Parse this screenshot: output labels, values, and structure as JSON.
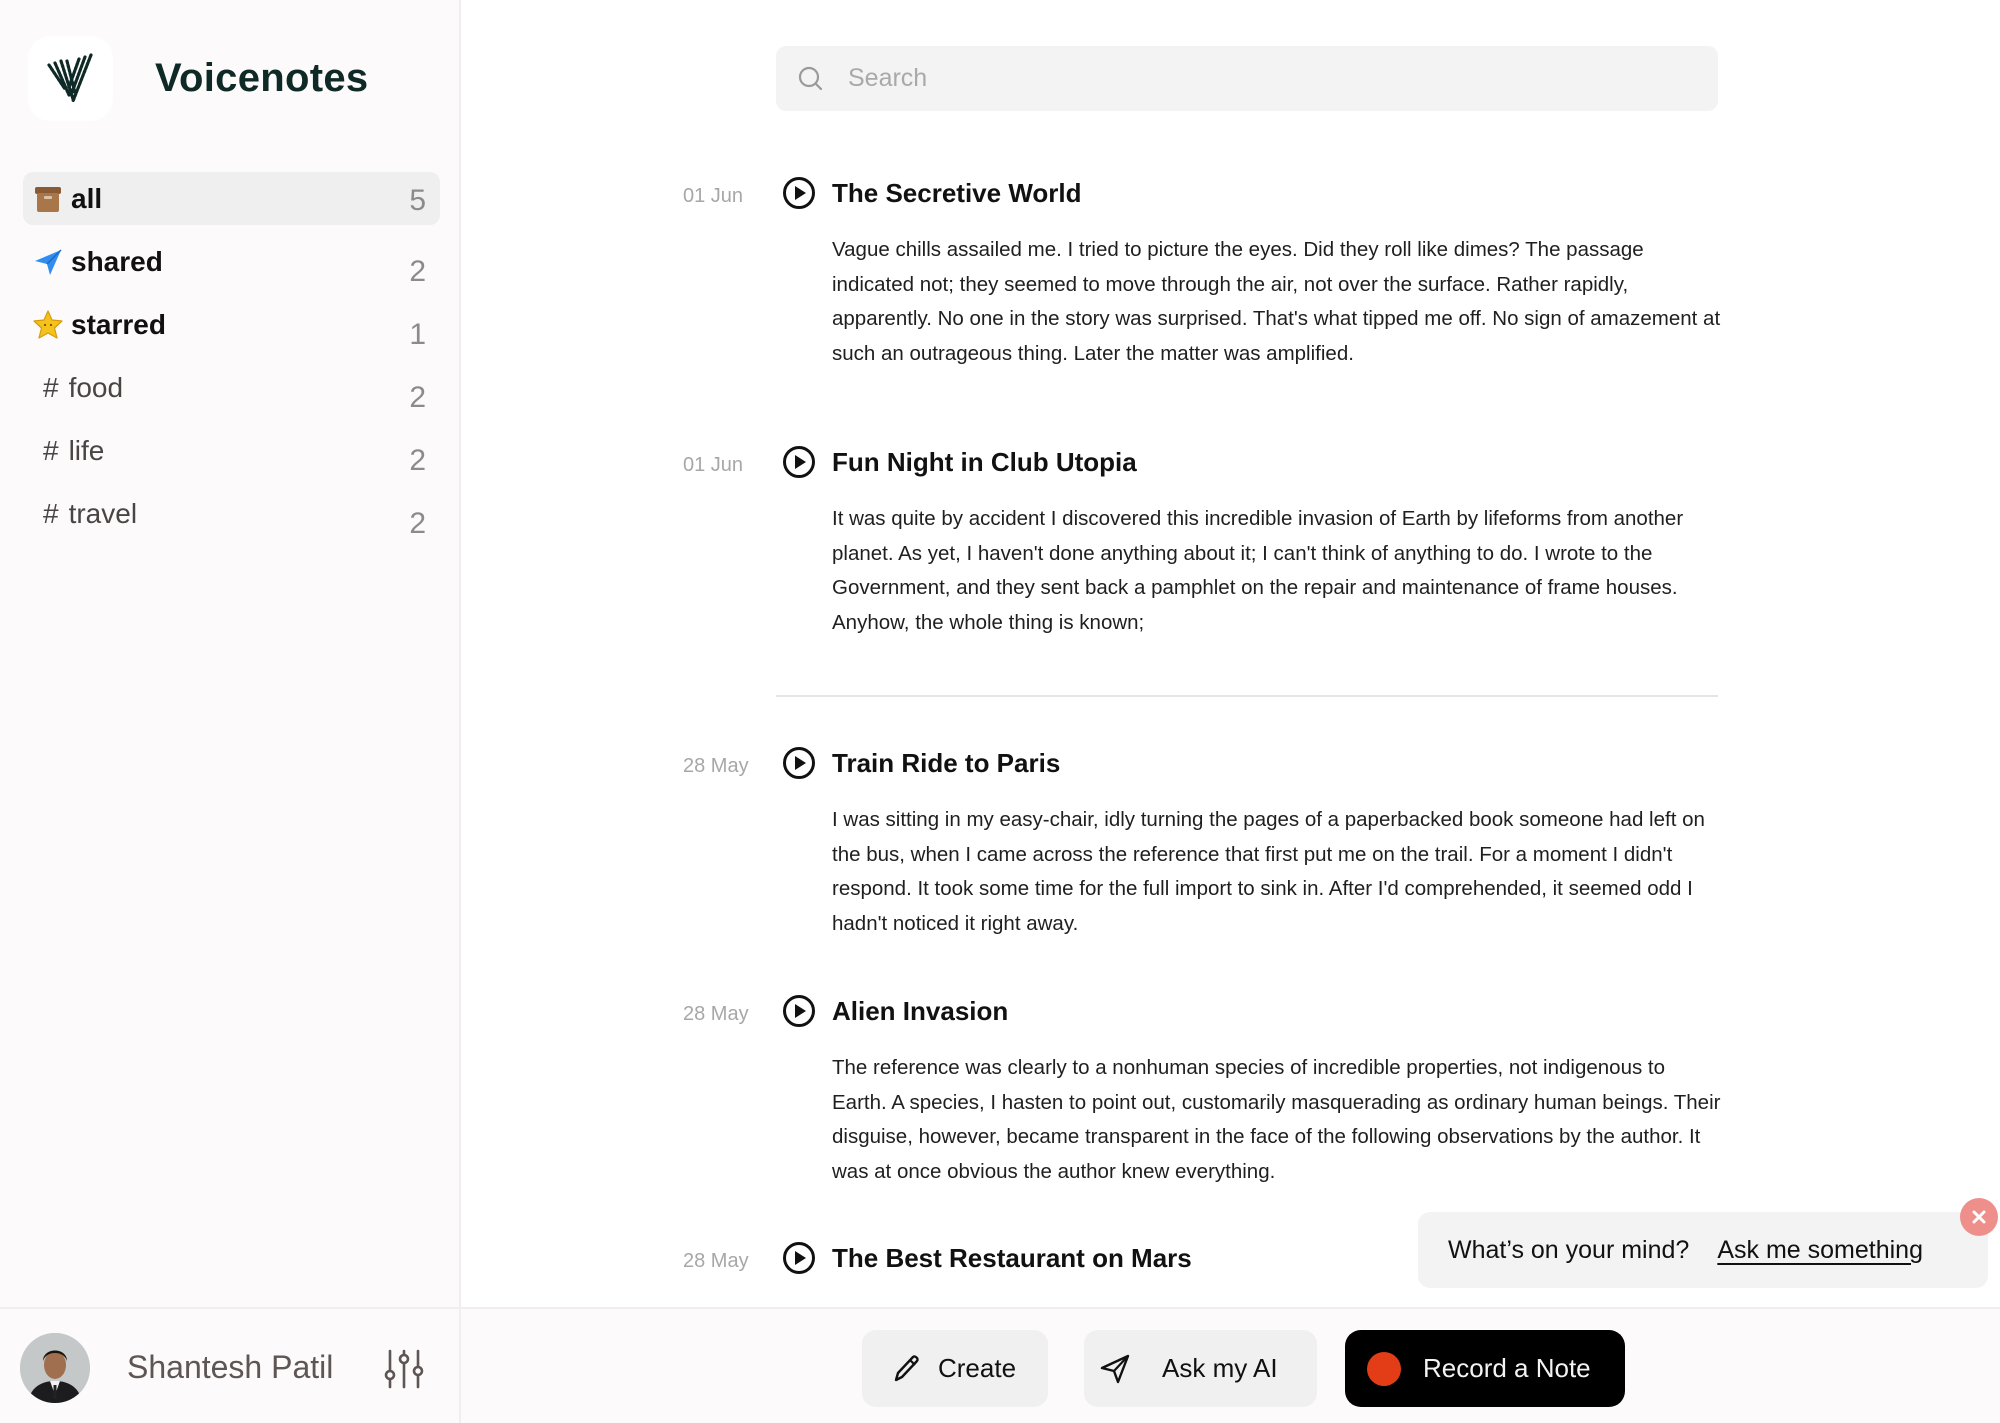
{
  "app": {
    "brand": "Voicenotes"
  },
  "sidebar": {
    "items": [
      {
        "label": "all",
        "count": "5",
        "icon": "archive-box-icon",
        "active": true
      },
      {
        "label": "shared",
        "count": "2",
        "icon": "paper-plane-icon"
      },
      {
        "label": "starred",
        "count": "1",
        "icon": "star-icon"
      },
      {
        "label": "food",
        "count": "2",
        "icon": "hash-icon",
        "prefix": "#"
      },
      {
        "label": "life",
        "count": "2",
        "icon": "hash-icon",
        "prefix": "#"
      },
      {
        "label": "travel",
        "count": "2",
        "icon": "hash-icon",
        "prefix": "#"
      }
    ]
  },
  "user": {
    "name": "Shantesh Patil"
  },
  "search": {
    "placeholder": "Search",
    "value": ""
  },
  "notes": [
    {
      "date": "01 Jun",
      "title": "The Secretive World",
      "body": "Vague chills assailed me. I tried to picture the eyes. Did they roll like dimes? The passage indicated not; they seemed to move through the air, not over the surface. Rather rapidly, apparently. No one in the story was surprised. That's what tipped me off. No sign of amazement at such an outrageous thing. Later the matter was amplified."
    },
    {
      "date": "01 Jun",
      "title": "Fun Night in Club Utopia",
      "body": "It was quite by accident I discovered this incredible invasion of Earth by lifeforms from another planet. As yet, I haven't done anything about it; I can't think of anything to do. I wrote to the Government, and they sent back a pamphlet on the repair and maintenance of frame houses. Anyhow, the whole thing is known;"
    },
    {
      "date": "28 May",
      "title": "Train Ride to Paris",
      "body": "I was sitting in my easy-chair, idly turning the pages of a paperbacked book someone had left on the bus, when I came across the reference that first put me on the trail. For a moment I didn't respond. It took some time for the full import to sink in. After I'd comprehended, it seemed odd I hadn't noticed it right away."
    },
    {
      "date": "28 May",
      "title": "Alien Invasion",
      "body": "The reference was clearly to a nonhuman species of incredible properties, not indigenous to Earth. A species, I hasten to point out, customarily masquerading as ordinary human beings. Their disguise, however, became transparent in the face of the following observations by the author. It was at once obvious the author knew everything."
    },
    {
      "date": "28 May",
      "title": "The Best Restaurant on Mars",
      "body": ""
    }
  ],
  "ask_popup": {
    "question": "What’s on your mind?",
    "link": "Ask me something"
  },
  "actions": {
    "create": "Create",
    "ask_ai": "Ask my AI",
    "record": "Record a Note"
  },
  "colors": {
    "brand_text": "#0f2a26",
    "record_button": "#000000",
    "record_dot": "#e23d17",
    "close_badge": "#ef8f8c",
    "shared_icon": "#2f8ef0",
    "starred_icon": "#f4c21b"
  }
}
